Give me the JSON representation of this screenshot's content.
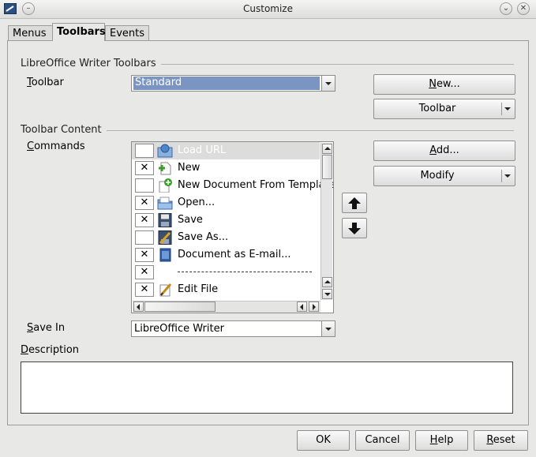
{
  "window": {
    "title": "Customize"
  },
  "tabs": [
    {
      "label": "Menus"
    },
    {
      "label": "Toolbars"
    },
    {
      "label": "Events"
    }
  ],
  "toolbars_section": {
    "heading": "LibreOffice Writer Toolbars",
    "toolbar_label_mnemonic": "T",
    "toolbar_label_rest": "oolbar",
    "toolbar_value": "Standard",
    "new_button_mnemonic": "N",
    "new_button_rest": "ew...",
    "toolbar_button": "Toolbar"
  },
  "content_section": {
    "heading": "Toolbar Content",
    "commands_label_mnemonic": "C",
    "commands_label_rest": "ommands",
    "add_button_mnemonic": "A",
    "add_button_rest": "dd...",
    "modify_button": "Modify",
    "commands": [
      {
        "label": "Load URL",
        "checked": false,
        "icon": "load-url-icon",
        "highlighted": true
      },
      {
        "label": "New",
        "checked": true,
        "icon": "new-document-icon"
      },
      {
        "label": "New Document From Template",
        "checked": false,
        "icon": "new-from-template-icon"
      },
      {
        "label": "Open...",
        "checked": true,
        "icon": "open-folder-icon"
      },
      {
        "label": "Save",
        "checked": true,
        "icon": "floppy-disk-icon"
      },
      {
        "label": "Save As...",
        "checked": false,
        "icon": "save-as-icon"
      },
      {
        "label": "Document as E-mail...",
        "checked": true,
        "icon": "email-document-icon"
      },
      {
        "label": "------------------------------------",
        "checked": true,
        "separator": true
      },
      {
        "label": "Edit File",
        "checked": true,
        "icon": "pencil-edit-icon"
      }
    ],
    "check_mark": "✕",
    "save_in_label_mnemonic": "S",
    "save_in_label_rest": "ave In",
    "save_in_value": "LibreOffice Writer"
  },
  "description": {
    "label_mnemonic": "D",
    "label_rest": "escription",
    "text": ""
  },
  "footer": {
    "ok": "OK",
    "cancel": "Cancel",
    "help_mnemonic": "H",
    "help_rest": "elp",
    "reset_mnemonic": "R",
    "reset_rest": "eset"
  },
  "colors": {
    "selection": "#7a95c2",
    "window_bg": "#e8e8e7"
  }
}
